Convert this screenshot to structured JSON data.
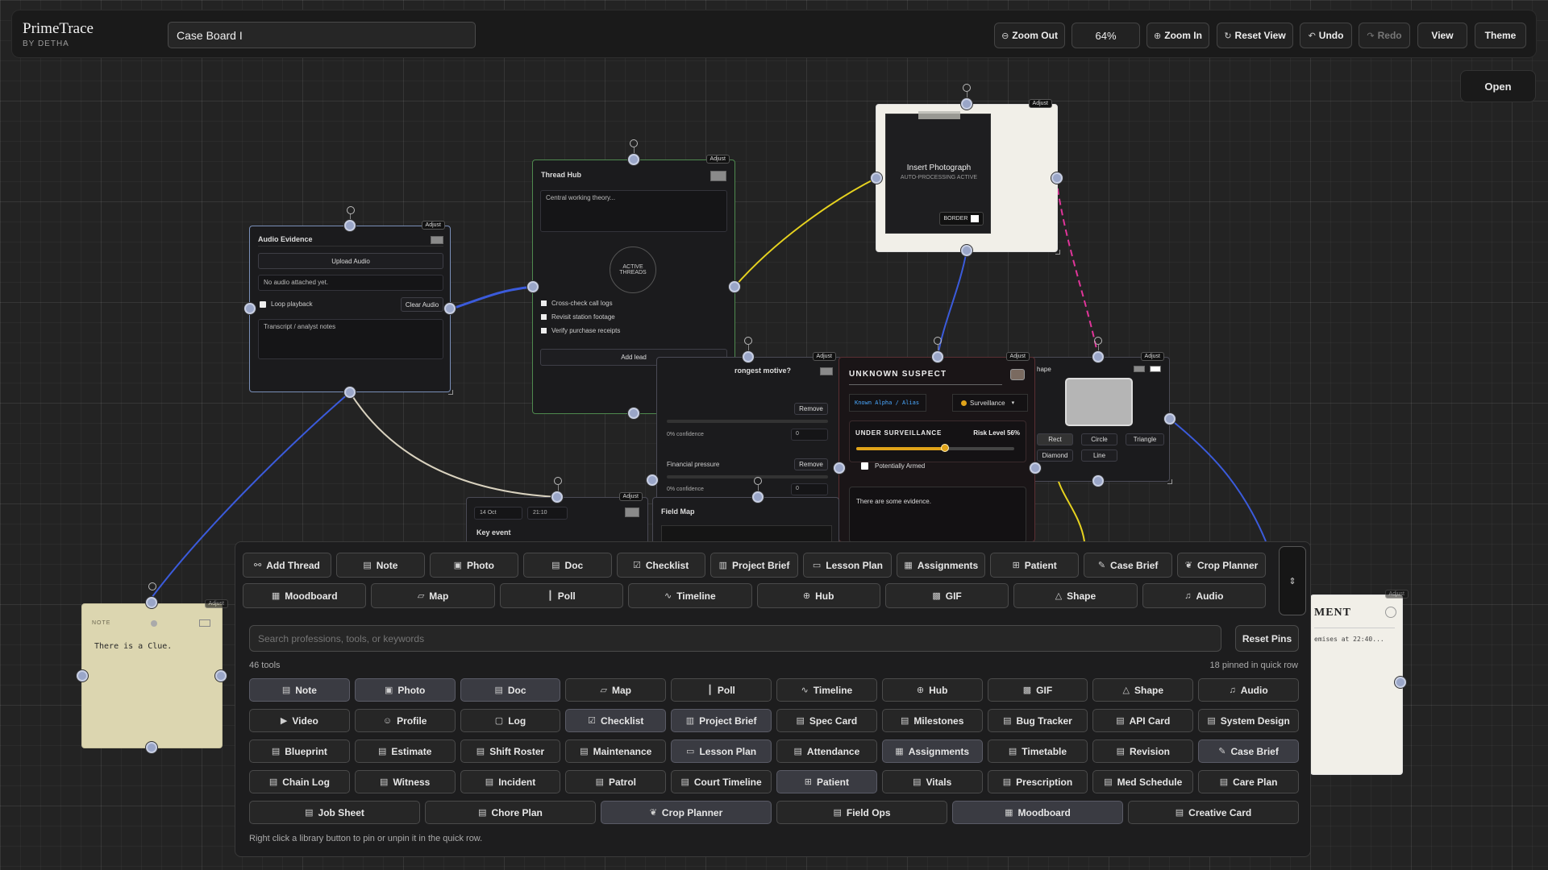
{
  "app": {
    "name": "PrimeTrace",
    "byline": "BY DETHA"
  },
  "board": {
    "title": "Case Board I"
  },
  "toolbar": {
    "zoom_out": "Zoom Out",
    "zoom_level": "64%",
    "zoom_in": "Zoom In",
    "reset_view": "Reset View",
    "undo": "Undo",
    "redo": "Redo",
    "view": "View",
    "theme": "Theme"
  },
  "open_button": "Open",
  "cards": {
    "adjust_label": "Adjust",
    "audio": {
      "title": "Audio Evidence",
      "upload": "Upload Audio",
      "status": "No audio attached yet.",
      "loop": "Loop playback",
      "clear": "Clear Audio",
      "notes_placeholder": "Transcript / analyst notes"
    },
    "hub": {
      "title": "Thread Hub",
      "theory_placeholder": "Central working theory...",
      "center_line1": "ACTIVE",
      "center_line2": "THREADS",
      "threads": [
        "Cross-check call logs",
        "Revisit station footage",
        "Verify purchase receipts"
      ],
      "add": "Add lead"
    },
    "photo": {
      "title": "Insert Photograph",
      "subtitle": "AUTO-PROCESSING ACTIVE",
      "border": "BORDER"
    },
    "motive": {
      "title": "rongest motive?",
      "remove": "Remove",
      "rows": [
        {
          "label": "",
          "confidence": "0% confidence",
          "value": "0"
        },
        {
          "label": "Financial pressure",
          "confidence": "0% confidence",
          "value": "0"
        }
      ]
    },
    "suspect": {
      "title": "UNKNOWN SUSPECT",
      "alias": "Known Alpha / Alias",
      "status_select": "Surveillance",
      "status_heading": "UNDER SURVEILLANCE",
      "risk_label": "Risk Level 56%",
      "risk": 0.56,
      "armed": "Potentially Armed",
      "notes": "There are some evidence."
    },
    "shape": {
      "title": "hape",
      "options": [
        "Rect",
        "Circle",
        "Triangle",
        "Diamond",
        "Line"
      ]
    },
    "timeline": {
      "date": "14 Oct",
      "time": "21:10",
      "title": "Key event"
    },
    "fieldmap": {
      "title": "Field Map"
    },
    "note": {
      "label": "NOTE",
      "text": "There is a Clue."
    },
    "statement": {
      "title": "MENT",
      "text": "emises at 22:40..."
    }
  },
  "quick_row": [
    [
      {
        "label": "Add Thread",
        "icon": "thread-icon"
      },
      {
        "label": "Note",
        "icon": "note-icon"
      },
      {
        "label": "Photo",
        "icon": "photo-icon"
      },
      {
        "label": "Doc",
        "icon": "doc-icon"
      },
      {
        "label": "Checklist",
        "icon": "checklist-icon"
      },
      {
        "label": "Project Brief",
        "icon": "brief-icon"
      },
      {
        "label": "Lesson Plan",
        "icon": "book-icon"
      },
      {
        "label": "Assignments",
        "icon": "clipboard-icon"
      },
      {
        "label": "Patient",
        "icon": "patient-icon"
      },
      {
        "label": "Case Brief",
        "icon": "pen-icon"
      },
      {
        "label": "Crop Planner",
        "icon": "leaf-icon"
      }
    ],
    [
      {
        "label": "Moodboard",
        "icon": "grid-icon"
      },
      {
        "label": "Map",
        "icon": "map-icon"
      },
      {
        "label": "Poll",
        "icon": "poll-icon"
      },
      {
        "label": "Timeline",
        "icon": "pulse-icon"
      },
      {
        "label": "Hub",
        "icon": "hub-icon"
      },
      {
        "label": "GIF",
        "icon": "gif-icon"
      },
      {
        "label": "Shape",
        "icon": "triangle-icon"
      },
      {
        "label": "Audio",
        "icon": "music-icon"
      }
    ]
  ],
  "library": {
    "search_placeholder": "Search professions, tools, or keywords",
    "reset_pins": "Reset Pins",
    "count": "46 tools",
    "pinned_info": "18 pinned in quick row",
    "hint": "Right click a library button to pin or unpin it in the quick row.",
    "rows": [
      [
        {
          "label": "Note",
          "icon": "note-icon",
          "pinned": true
        },
        {
          "label": "Photo",
          "icon": "photo-icon",
          "pinned": true
        },
        {
          "label": "Doc",
          "icon": "doc-icon",
          "pinned": true
        },
        {
          "label": "Map",
          "icon": "map-icon",
          "pinned": false
        },
        {
          "label": "Poll",
          "icon": "poll-icon",
          "pinned": false
        },
        {
          "label": "Timeline",
          "icon": "pulse-icon",
          "pinned": false
        },
        {
          "label": "Hub",
          "icon": "hub-icon",
          "pinned": false
        },
        {
          "label": "GIF",
          "icon": "gif-icon",
          "pinned": false
        },
        {
          "label": "Shape",
          "icon": "triangle-icon",
          "pinned": false
        },
        {
          "label": "Audio",
          "icon": "music-icon",
          "pinned": false
        }
      ],
      [
        {
          "label": "Video",
          "icon": "video-icon",
          "pinned": false
        },
        {
          "label": "Profile",
          "icon": "user-icon",
          "pinned": false
        },
        {
          "label": "Log",
          "icon": "chat-icon",
          "pinned": false
        },
        {
          "label": "Checklist",
          "icon": "checklist-icon",
          "pinned": true
        },
        {
          "label": "Project Brief",
          "icon": "brief-icon",
          "pinned": true
        },
        {
          "label": "Spec Card",
          "icon": "doc-icon",
          "pinned": false
        },
        {
          "label": "Milestones",
          "icon": "doc-icon",
          "pinned": false
        },
        {
          "label": "Bug Tracker",
          "icon": "doc-icon",
          "pinned": false
        },
        {
          "label": "API Card",
          "icon": "doc-icon",
          "pinned": false
        },
        {
          "label": "System Design",
          "icon": "doc-icon",
          "pinned": false
        }
      ],
      [
        {
          "label": "Blueprint",
          "icon": "doc-icon",
          "pinned": false
        },
        {
          "label": "Estimate",
          "icon": "doc-icon",
          "pinned": false
        },
        {
          "label": "Shift Roster",
          "icon": "doc-icon",
          "pinned": false
        },
        {
          "label": "Maintenance",
          "icon": "doc-icon",
          "pinned": false
        },
        {
          "label": "Lesson Plan",
          "icon": "book-icon",
          "pinned": true
        },
        {
          "label": "Attendance",
          "icon": "doc-icon",
          "pinned": false
        },
        {
          "label": "Assignments",
          "icon": "clipboard-icon",
          "pinned": true
        },
        {
          "label": "Timetable",
          "icon": "doc-icon",
          "pinned": false
        },
        {
          "label": "Revision",
          "icon": "doc-icon",
          "pinned": false
        },
        {
          "label": "Case Brief",
          "icon": "pen-icon",
          "pinned": true
        }
      ],
      [
        {
          "label": "Chain Log",
          "icon": "doc-icon",
          "pinned": false
        },
        {
          "label": "Witness",
          "icon": "doc-icon",
          "pinned": false
        },
        {
          "label": "Incident",
          "icon": "doc-icon",
          "pinned": false
        },
        {
          "label": "Patrol",
          "icon": "doc-icon",
          "pinned": false
        },
        {
          "label": "Court Timeline",
          "icon": "doc-icon",
          "pinned": false
        },
        {
          "label": "Patient",
          "icon": "patient-icon",
          "pinned": true
        },
        {
          "label": "Vitals",
          "icon": "doc-icon",
          "pinned": false
        },
        {
          "label": "Prescription",
          "icon": "doc-icon",
          "pinned": false
        },
        {
          "label": "Med Schedule",
          "icon": "doc-icon",
          "pinned": false
        },
        {
          "label": "Care Plan",
          "icon": "doc-icon",
          "pinned": false
        }
      ],
      [
        {
          "label": "Job Sheet",
          "icon": "doc-icon",
          "pinned": false
        },
        {
          "label": "Chore Plan",
          "icon": "doc-icon",
          "pinned": false
        },
        {
          "label": "Crop Planner",
          "icon": "leaf-icon",
          "pinned": true
        },
        {
          "label": "Field Ops",
          "icon": "doc-icon",
          "pinned": false
        },
        {
          "label": "Moodboard",
          "icon": "grid-icon",
          "pinned": true
        },
        {
          "label": "Creative Card",
          "icon": "doc-icon",
          "pinned": false
        }
      ]
    ]
  },
  "colors": {
    "wire_blue": "#3b5bdb",
    "wire_yellow": "#e6d21f",
    "wire_pink": "#e0359a",
    "wire_cream": "#d9d2bf",
    "risk_fill": "#e0a31a",
    "note_paper": "#dcd6b0"
  }
}
